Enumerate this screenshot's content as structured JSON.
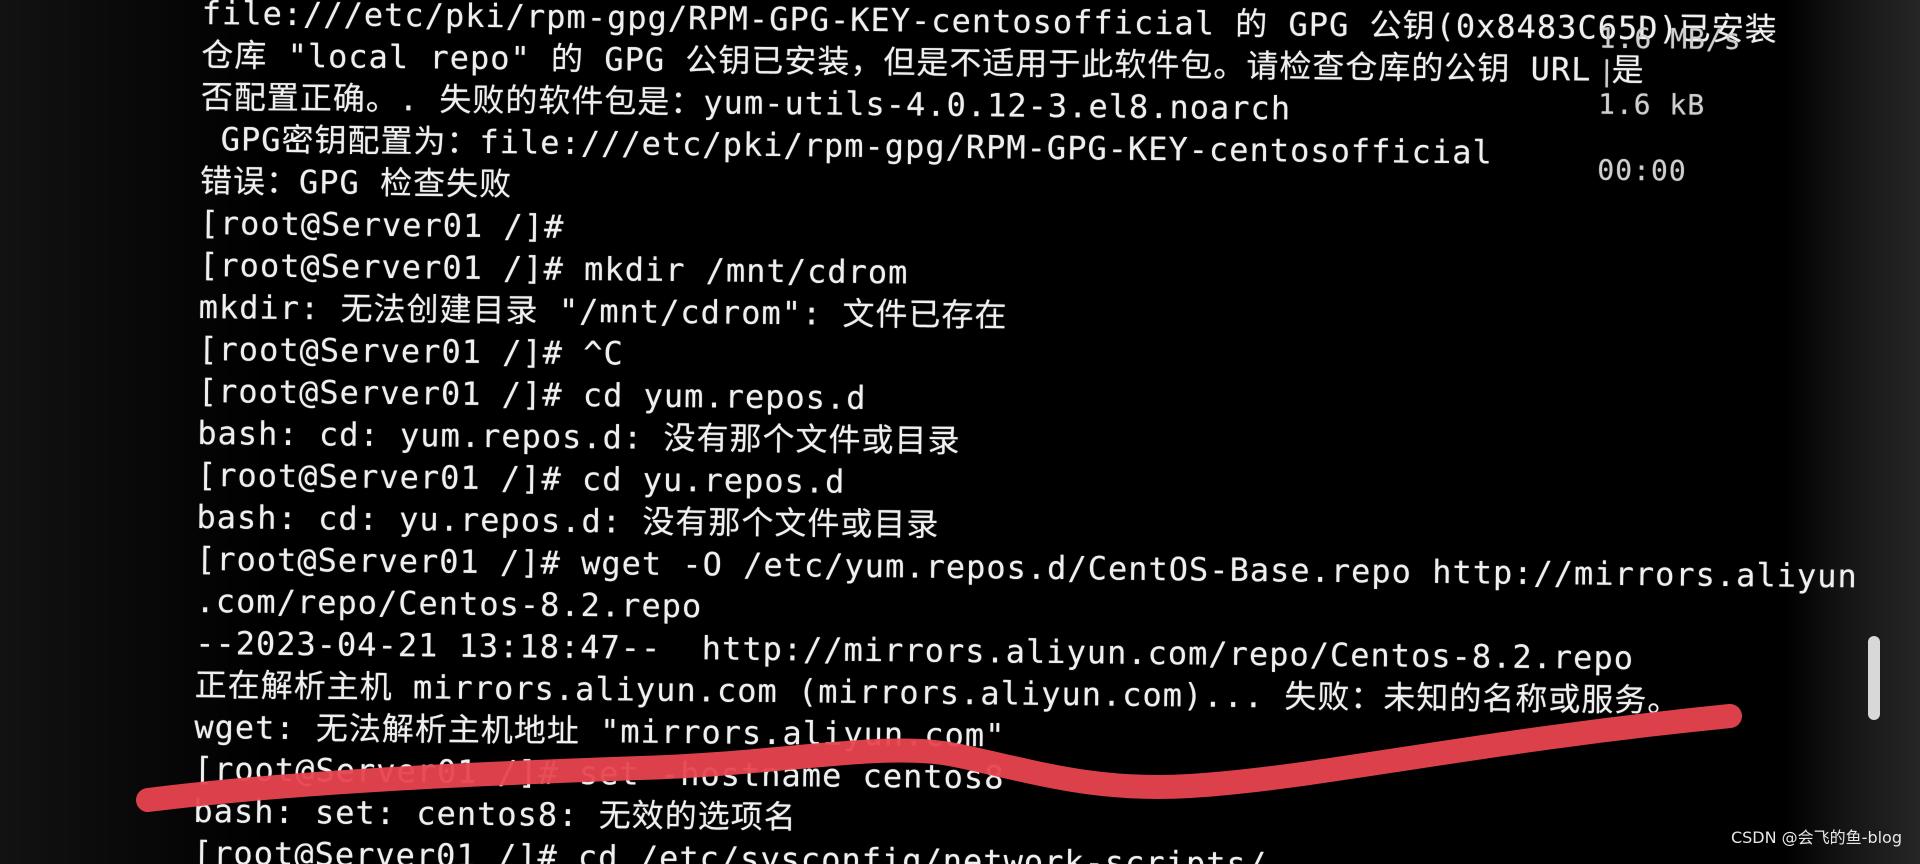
{
  "transfer_status": {
    "speed": "1.6 MB/s",
    "separator": "|",
    "size": "1.6 kB",
    "eta": "00:00"
  },
  "terminal": {
    "lines": [
      "file:///etc/pki/rpm-gpg/RPM-GPG-KEY-centosofficial 的 GPG 公钥(0x8483C65D)已安装",
      "仓库 \"local repo\" 的 GPG 公钥已安装，但是不适用于此软件包。请检查仓库的公钥 URL 是",
      "否配置正确。. 失败的软件包是：yum-utils-4.0.12-3.el8.noarch",
      " GPG密钥配置为：file:///etc/pki/rpm-gpg/RPM-GPG-KEY-centosofficial",
      "错误：GPG 检查失败",
      "[root@Server01 /]#",
      "[root@Server01 /]# mkdir /mnt/cdrom",
      "mkdir: 无法创建目录 \"/mnt/cdrom\": 文件已存在",
      "[root@Server01 /]# ^C",
      "[root@Server01 /]# cd yum.repos.d",
      "bash: cd: yum.repos.d: 没有那个文件或目录",
      "[root@Server01 /]# cd yu.repos.d",
      "bash: cd: yu.repos.d: 没有那个文件或目录",
      "[root@Server01 /]# wget -O /etc/yum.repos.d/CentOS-Base.repo http://mirrors.aliyun",
      ".com/repo/Centos-8.2.repo",
      "--2023-04-21 13:18:47--  http://mirrors.aliyun.com/repo/Centos-8.2.repo",
      "正在解析主机 mirrors.aliyun.com (mirrors.aliyun.com)... 失败：未知的名称或服务。",
      "wget: 无法解析主机地址 \"mirrors.aliyun.com\"",
      "[root@Server01 /]# set -hostname centos8",
      "bash: set: centos8: 无效的选项名",
      "[root@Server01 /]# cd /etc/sysconfig/network-scripts/"
    ]
  },
  "annotation": {
    "color": "#e8454f"
  },
  "watermark": {
    "text": "CSDN @会飞的鱼-blog"
  }
}
